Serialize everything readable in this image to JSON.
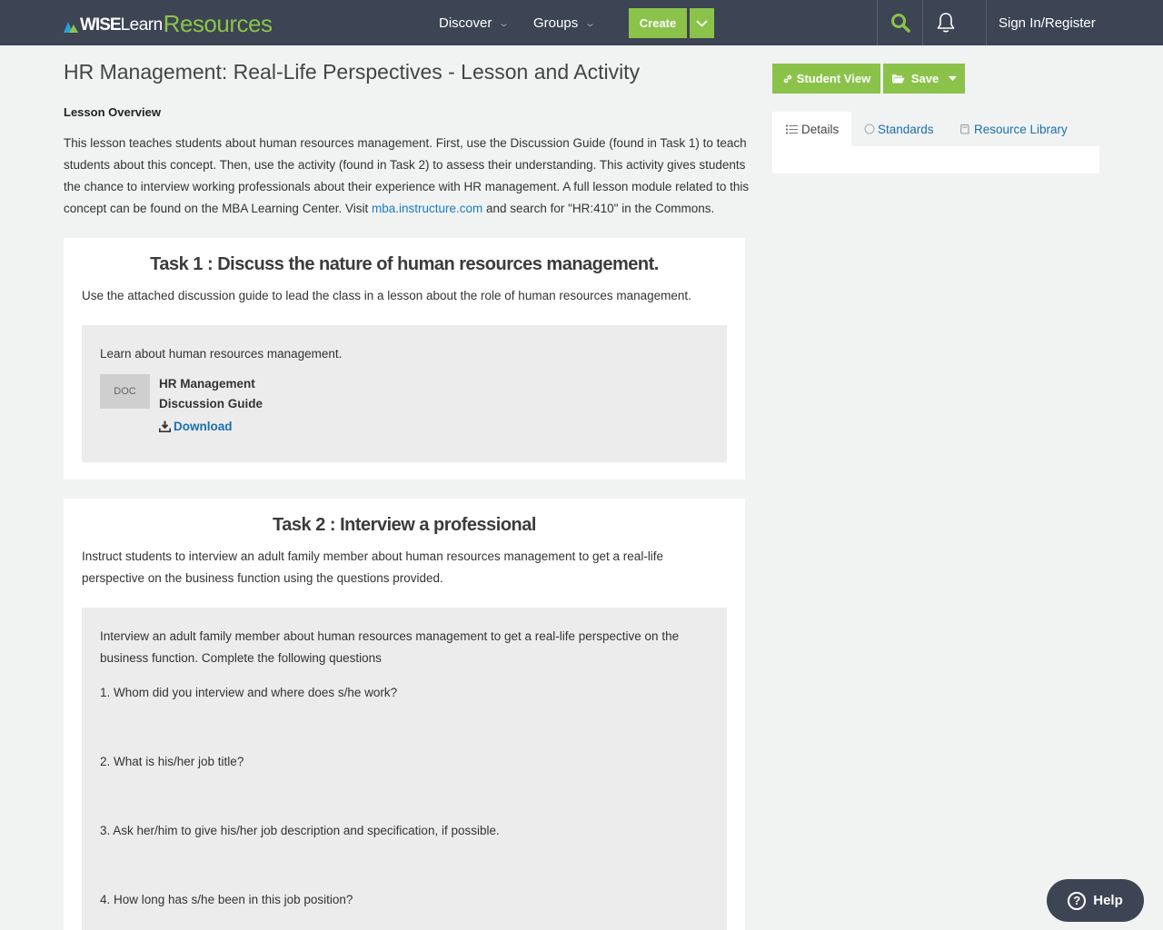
{
  "nav": {
    "logo": {
      "wise": "WISE",
      "learn": "Learn",
      "resources": "Resources"
    },
    "discover": "Discover",
    "groups": "Groups",
    "create": "Create",
    "signin": "Sign In/Register"
  },
  "page": {
    "title": "HR Management: Real-Life Perspectives - Lesson and Activity",
    "overview_heading": "Lesson Overview",
    "overview_text_1": "This lesson teaches students about human resources management. First, use the Discussion Guide (found in Task 1) to teach students about this concept. Then, use the activity (found in Task 2) to assess their understanding. This activity gives students the chance to interview working professionals about their experience with HR management. A full lesson module related to this concept can be found on the MBA Learning Center. Visit ",
    "overview_link": "mba.instructure.com",
    "overview_text_2": " and search for \"HR:410\" in the Commons."
  },
  "task1": {
    "title": "Task 1 : Discuss the nature of human resources management.",
    "description": "Use the attached discussion guide to lead the class in a lesson about the role of human resources management.",
    "box_text": "Learn about human resources management.",
    "doc_label": "DOC",
    "doc_title": "HR Management Discussion Guide",
    "download": "Download"
  },
  "task2": {
    "title": "Task 2 : Interview a professional",
    "description": "Instruct students to interview an adult family member about human resources management to get a real-life perspective on the business function using the questions provided.",
    "box_text": "Interview an adult family member about human resources management to get a real-life perspective on the business function. Complete the following questions",
    "questions": [
      "1.  Whom did you interview and where does s/he work?",
      "2.  What is his/her job title?",
      "3.  Ask her/him to give his/her job description and specification, if possible.",
      "4.  How long has s/he been in this job position?"
    ]
  },
  "sidebar": {
    "student_view": "Student View",
    "save": "Save",
    "tabs": [
      "Details",
      "Standards",
      "Resource Library"
    ]
  },
  "help": "Help",
  "colors": {
    "nav_bg": "#3d4453",
    "accent_green": "#8bc34a",
    "link_blue": "#1a6fb0"
  }
}
